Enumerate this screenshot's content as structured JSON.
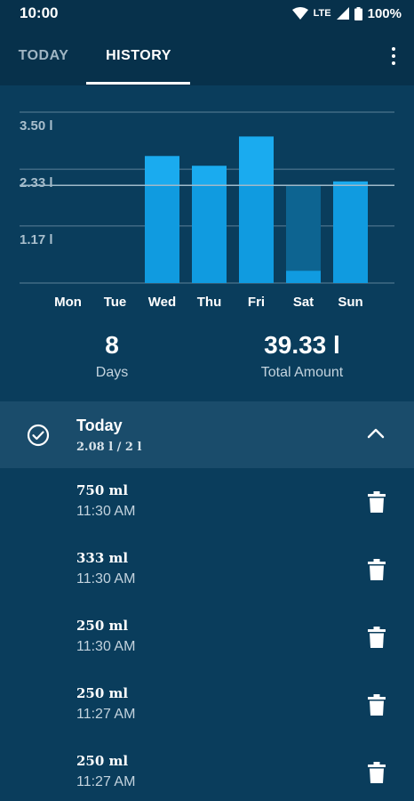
{
  "status_bar": {
    "time": "10:00",
    "network": "LTE",
    "battery": "100%"
  },
  "tabs": [
    {
      "label": "TODAY",
      "active": false
    },
    {
      "label": "HISTORY",
      "active": true
    }
  ],
  "chart_data": {
    "type": "bar",
    "categories": [
      "Mon",
      "Tue",
      "Wed",
      "Thu",
      "Fri",
      "Sat",
      "Sun"
    ],
    "series": [
      {
        "values": [
          0,
          0,
          2.6,
          2.4,
          3.0,
          0.25,
          2.08
        ]
      },
      {
        "values": [
          0,
          0,
          0,
          0,
          0,
          2.0,
          0
        ]
      }
    ],
    "ytick_labels": [
      "3.50 l",
      "2.33 l",
      "1.17 l"
    ],
    "yticks": [
      3.5,
      2.33,
      1.17
    ],
    "goal": 2.0,
    "ylim": [
      0,
      3.5
    ],
    "grid": true,
    "colors": {
      "bar": "#109be0",
      "bar_top": "#1aabef",
      "goal_line": "#9fb9c9",
      "remaining": "#0d6491",
      "tick_label": "#a9bfcd",
      "cat_label": "#ffffff"
    }
  },
  "stats": {
    "days_value": "8",
    "days_label": "Days",
    "total_value": "39.33 l",
    "total_label": "Total Amount"
  },
  "day": {
    "title": "Today",
    "subtitle": "2.08 l / 2 l"
  },
  "entries": [
    {
      "amount": "750 ml",
      "time": "11:30 AM"
    },
    {
      "amount": "333 ml",
      "time": "11:30 AM"
    },
    {
      "amount": "250 ml",
      "time": "11:30 AM"
    },
    {
      "amount": "250 ml",
      "time": "11:27 AM"
    },
    {
      "amount": "250 ml",
      "time": "11:27 AM"
    }
  ],
  "icons": {
    "check": "check-circle-icon",
    "chevron": "chevron-up-icon",
    "trash": "trash-icon",
    "menu": "more-vert-icon"
  }
}
